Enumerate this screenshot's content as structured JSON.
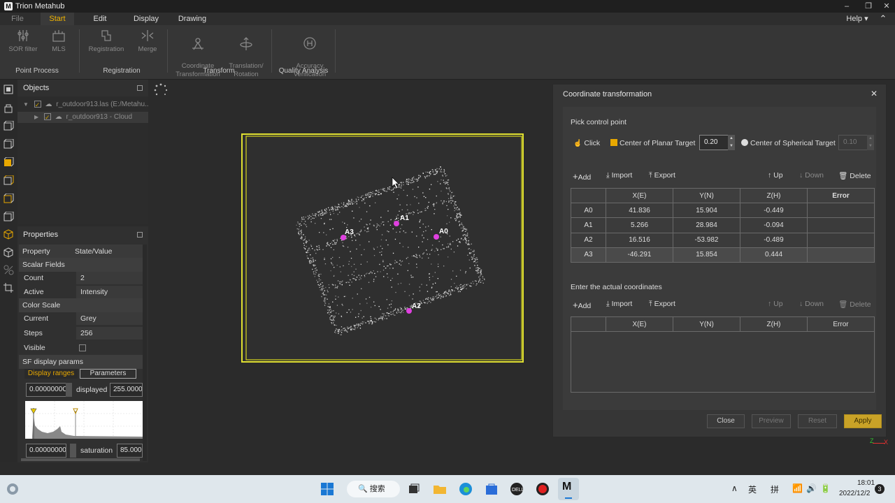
{
  "app": {
    "title": "Trion Metahub"
  },
  "window_controls": [
    "–",
    "❐",
    "✕"
  ],
  "menu": {
    "items": [
      {
        "label": "File"
      },
      {
        "label": "Start"
      },
      {
        "label": "Edit"
      },
      {
        "label": "Display"
      },
      {
        "label": "Drawing"
      }
    ],
    "help": "Help ▾"
  },
  "ribbon": {
    "buttons": [
      {
        "label": "SOR filter",
        "icon": "sor-filter-icon"
      },
      {
        "label": "MLS",
        "icon": "mls-icon"
      },
      {
        "label": "Registration",
        "icon": "registration-icon"
      },
      {
        "label": "Merge",
        "icon": "merge-icon"
      },
      {
        "label": "Coordinate\nTransformation",
        "icon": "coordinate-transformation-icon"
      },
      {
        "label": "Translation/\nRotation",
        "icon": "translation-rotation-icon"
      },
      {
        "label": "Accuracy\nVerification",
        "icon": "accuracy-verification-icon"
      }
    ],
    "groups": [
      "Point Process",
      "Registration",
      "Transform",
      "Quality Analysis"
    ]
  },
  "objects_panel": {
    "title": "Objects",
    "tree": [
      {
        "label": "r_outdoor913.las (E:/Metahu..."
      },
      {
        "label": "r_outdoor913 - Cloud"
      }
    ]
  },
  "properties_panel": {
    "title": "Properties",
    "header": {
      "property": "Property",
      "value": "State/Value"
    },
    "scalar_fields": "Scalar Fields",
    "count": {
      "label": "Count",
      "value": "2"
    },
    "active": {
      "label": "Active",
      "value": "Intensity"
    },
    "color_scale": "Color Scale",
    "current": {
      "label": "Current",
      "value": "Grey"
    },
    "steps": {
      "label": "Steps",
      "value": "256"
    },
    "visible": {
      "label": "Visible"
    },
    "sf_display": "SF display params",
    "tabs": [
      "Display ranges",
      "Parameters"
    ],
    "displayed_min": "0.0000000C",
    "displayed_label": "displayed",
    "displayed_max": "255.0000",
    "saturation_min": "0.00000000",
    "saturation_label": "saturation",
    "saturation_max": "85.0000"
  },
  "viewport": {
    "points": [
      {
        "label": "A0"
      },
      {
        "label": "A1"
      },
      {
        "label": "A2"
      },
      {
        "label": "A3"
      }
    ]
  },
  "dialog": {
    "title": "Coordinate transformation",
    "pick_title": "Pick control point",
    "click_label": "Click",
    "planar_label": "Center of Planar Target",
    "planar_value": "0.20",
    "spherical_label": "Center of Spherical Target",
    "spherical_value": "0.10",
    "actions": {
      "add": "Add",
      "import": "Import",
      "export": "Export",
      "up": "Up",
      "down": "Down",
      "delete": "Delete"
    },
    "columns": [
      "",
      "X(E)",
      "Y(N)",
      "Z(H)",
      "Error"
    ],
    "rows": [
      [
        "A0",
        "41.836",
        "15.904",
        "-0.449",
        ""
      ],
      [
        "A1",
        "5.266",
        "28.984",
        "-0.094",
        ""
      ],
      [
        "A2",
        "16.516",
        "-53.982",
        "-0.489",
        ""
      ],
      [
        "A3",
        "-46.291",
        "15.854",
        "0.444",
        ""
      ]
    ],
    "actual_title": "Enter the actual coordinates",
    "footer": {
      "close": "Close",
      "preview": "Preview",
      "reset": "Reset",
      "apply": "Apply"
    }
  },
  "taskbar": {
    "search": "搜索",
    "ime": [
      "英",
      "拼"
    ],
    "time": "18:01",
    "date": "2022/12/2",
    "notifications": "3"
  }
}
